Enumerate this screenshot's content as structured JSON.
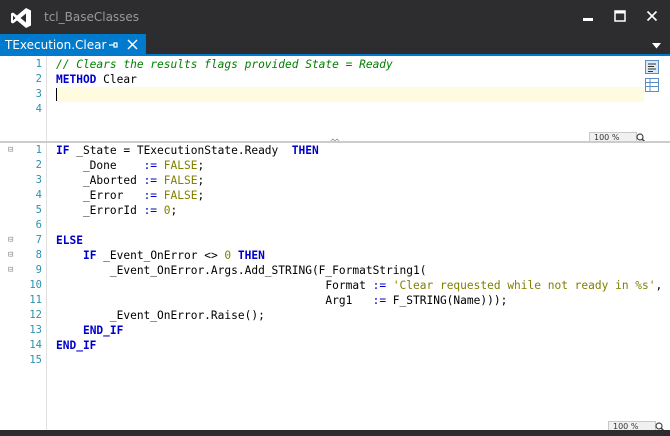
{
  "window": {
    "title": "tcl_BaseClasses",
    "logo_icon": "visual-studio-logo-icon",
    "controls": [
      "minimize-icon",
      "maximize-icon",
      "close-icon"
    ]
  },
  "tab": {
    "label": "TExecution.Clear",
    "pin_icon": "pin-icon",
    "close_icon": "close-icon"
  },
  "declaration_pane": {
    "line_numbers": [
      "1",
      "2",
      "3",
      "4"
    ],
    "lines": [
      [
        {
          "t": "// Clears the results flags provided State = Ready",
          "c": "cm"
        }
      ],
      [
        {
          "t": "METHOD",
          "c": "kw"
        },
        {
          "t": " Clear",
          "c": ""
        }
      ],
      [],
      []
    ],
    "zoom": "100 %"
  },
  "implementation_pane": {
    "line_numbers": [
      "1",
      "2",
      "3",
      "4",
      "5",
      "6",
      "7",
      "8",
      "9",
      "10",
      "11",
      "12",
      "13",
      "14",
      "15"
    ],
    "fold_markers": {
      "1": "⊟",
      "7": "⊟",
      "8": "⊟",
      "9": "⊟"
    },
    "lines": [
      [
        {
          "t": "IF",
          "c": "kw"
        },
        {
          "t": " _State = TExecutionState.Ready  ",
          "c": ""
        },
        {
          "t": "THEN",
          "c": "kw"
        }
      ],
      [
        {
          "t": "    _Done    ",
          "c": ""
        },
        {
          "t": ":=",
          "c": "op"
        },
        {
          "t": " ",
          "c": ""
        },
        {
          "t": "FALSE",
          "c": "nm"
        },
        {
          "t": ";",
          "c": ""
        }
      ],
      [
        {
          "t": "    _Aborted ",
          "c": ""
        },
        {
          "t": ":=",
          "c": "op"
        },
        {
          "t": " ",
          "c": ""
        },
        {
          "t": "FALSE",
          "c": "nm"
        },
        {
          "t": ";",
          "c": ""
        }
      ],
      [
        {
          "t": "    _Error   ",
          "c": ""
        },
        {
          "t": ":=",
          "c": "op"
        },
        {
          "t": " ",
          "c": ""
        },
        {
          "t": "FALSE",
          "c": "nm"
        },
        {
          "t": ";",
          "c": ""
        }
      ],
      [
        {
          "t": "    _ErrorId ",
          "c": ""
        },
        {
          "t": ":=",
          "c": "op"
        },
        {
          "t": " ",
          "c": ""
        },
        {
          "t": "0",
          "c": "nm"
        },
        {
          "t": ";",
          "c": ""
        }
      ],
      [],
      [
        {
          "t": "ELSE",
          "c": "kw"
        }
      ],
      [
        {
          "t": "    ",
          "c": ""
        },
        {
          "t": "IF",
          "c": "kw"
        },
        {
          "t": " _Event_OnError <> ",
          "c": ""
        },
        {
          "t": "0",
          "c": "nm"
        },
        {
          "t": " ",
          "c": ""
        },
        {
          "t": "THEN",
          "c": "kw"
        }
      ],
      [
        {
          "t": "        _Event_OnError.Args.Add_STRING(F_FormatString1(",
          "c": ""
        }
      ],
      [
        {
          "t": "                                        Format ",
          "c": ""
        },
        {
          "t": ":=",
          "c": "op"
        },
        {
          "t": " ",
          "c": ""
        },
        {
          "t": "'Clear requested while not ready in %s'",
          "c": "st"
        },
        {
          "t": ",",
          "c": ""
        }
      ],
      [
        {
          "t": "                                        Arg1   ",
          "c": ""
        },
        {
          "t": ":=",
          "c": "op"
        },
        {
          "t": " F_STRING(Name)));",
          "c": ""
        }
      ],
      [
        {
          "t": "        _Event_OnError.Raise();",
          "c": ""
        }
      ],
      [
        {
          "t": "    ",
          "c": ""
        },
        {
          "t": "END_IF",
          "c": "kw"
        }
      ],
      [
        {
          "t": "END_IF",
          "c": "kw"
        }
      ],
      []
    ],
    "zoom": "100 %"
  },
  "colors": {
    "accent": "#007acc",
    "chrome": "#2d2d30",
    "keyword": "#0000cd",
    "comment": "#008000",
    "literal": "#808000",
    "line_number": "#2b91af"
  }
}
